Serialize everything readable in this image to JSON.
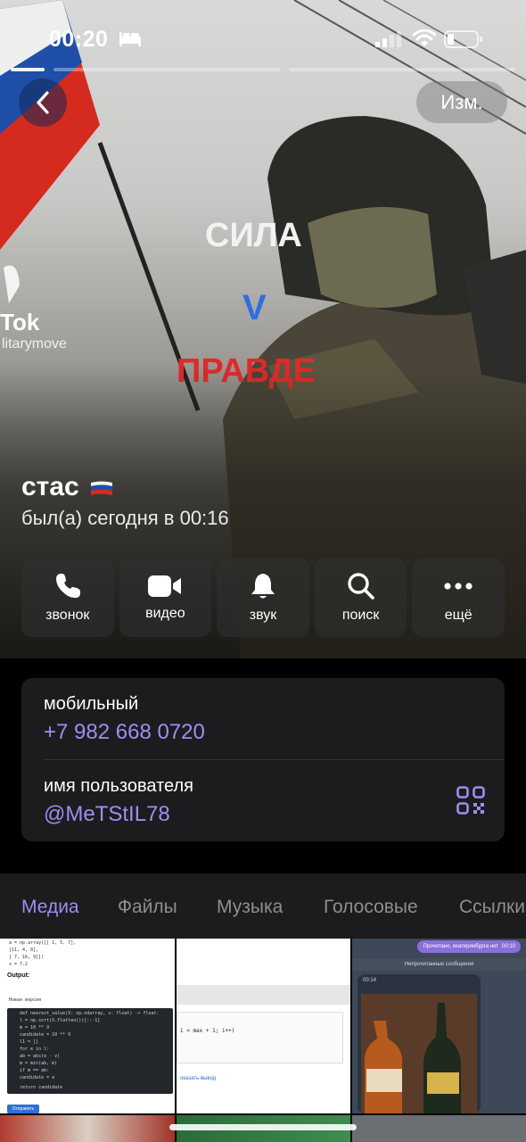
{
  "status_bar": {
    "time": "00:20"
  },
  "header": {
    "edit_label": "Изм."
  },
  "hero_text": {
    "line1": "СИЛА",
    "line2": "V",
    "line3": "ПРАВДЕ",
    "tiktok": "Tok",
    "handle": "litarymove"
  },
  "profile": {
    "name": "стас",
    "status": "был(а) сегодня в 00:16"
  },
  "actions": [
    {
      "label": "звонок",
      "icon": "phone-icon"
    },
    {
      "label": "видео",
      "icon": "video-camera-icon"
    },
    {
      "label": "звук",
      "icon": "bell-icon"
    },
    {
      "label": "поиск",
      "icon": "search-icon"
    },
    {
      "label": "ещё",
      "icon": "more-dots-icon"
    }
  ],
  "info": {
    "phone_label": "мобильный",
    "phone_value": "+7 982 668 0720",
    "username_label": "имя пользователя",
    "username_value": "@MeTStIL78"
  },
  "tabs": [
    "Медиа",
    "Файлы",
    "Музыка",
    "Голосовые",
    "Ссылки"
  ],
  "media": {
    "code_output_label": "Output:",
    "code_lines": [
      "a = np.array([[ 1,  5, 7],",
      "              [11,  4,  8],",
      "              [ 7, 16,  9]])",
      "x = 7.2"
    ],
    "code_version": "Новая версия",
    "editor_lines": [
      "def nearest_value(X: np.ndarray, v: float) -> float:",
      "    l = np.sort(X.flatten())[::-1]",
      "    m = 10 ** 9",
      "    candidate = 10 ** 9",
      "    l1 = []",
      "    for e in l:",
      "        ab = abs(e - v)",
      "        m = min(ab, m)",
      "        if m == ab:",
      "            candidate = e",
      "    return candidate"
    ],
    "run_label": "Отправить",
    "web_code": "i < max + 1; i++)",
    "web_link": "оказать вывод",
    "chat_bubble": "Прочитано, екатеринбурга нет",
    "chat_bubble_time": "00:10",
    "chat_unread": "Непрочитанные сообщения",
    "chat_msg_time": "00:14"
  }
}
